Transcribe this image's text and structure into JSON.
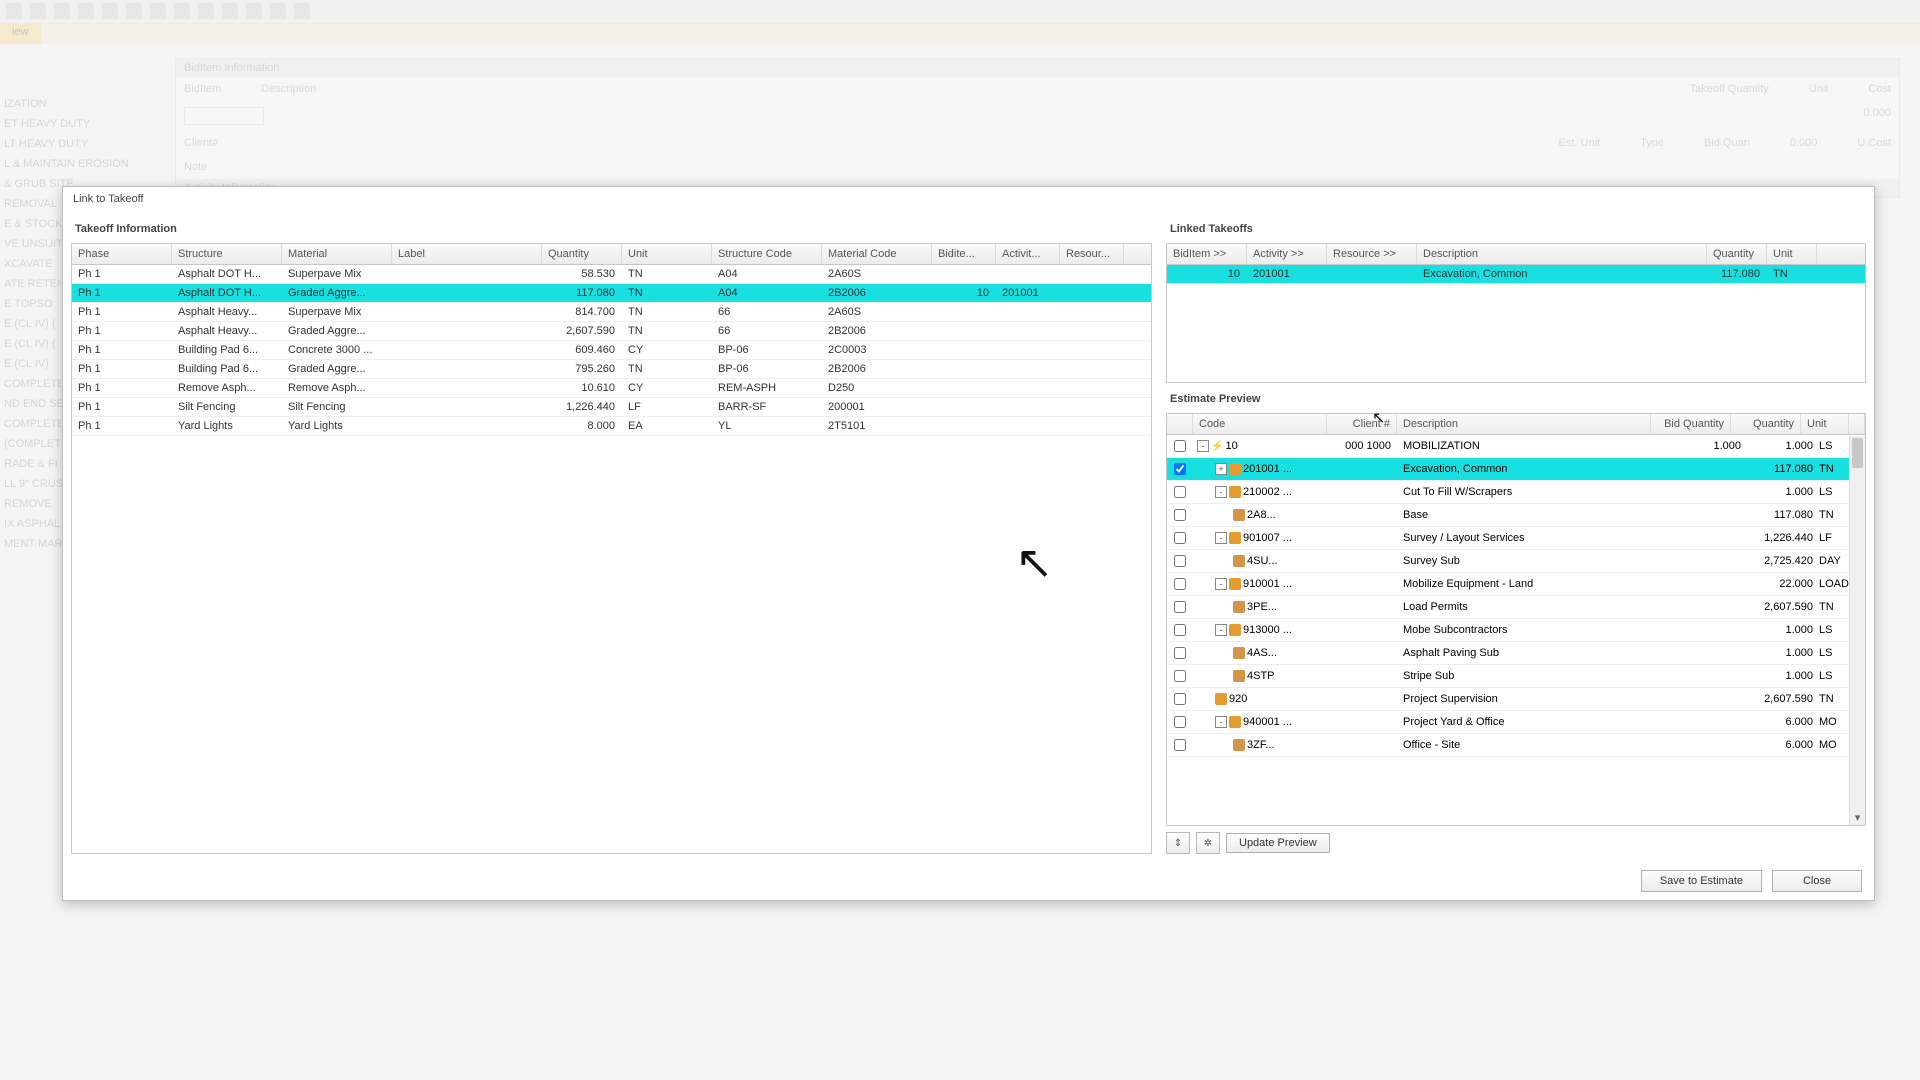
{
  "bg": {
    "tab": "iew",
    "bidItemInfo": "BidItem Information",
    "labels": {
      "biditem": "BidItem",
      "description": "Description",
      "client": "Client#",
      "takeoffQty": "Takeoff Quantity",
      "unit": "Unit",
      "cost": "Cost",
      "estUnit": "Est. Unit",
      "type": "Type",
      "bidQuan": "Bid Quan",
      "ucost": "U.Cost",
      "note": "Note",
      "activityInfo": "Activity Information",
      "qtyVal": "0.000",
      "qtyVal2": "0.000"
    },
    "side": [
      "IZATION",
      "ET HEAVY DUTY",
      "LT HEAVY DUTY",
      "L & MAINTAIN EROSION",
      "& GRUB SITE",
      "REMOVAL",
      "E & STOCK",
      "VE UNSUIT",
      "XCAVATE",
      "ATE RETEN",
      "E TOPSO",
      "E (CL IV) (",
      "E (CL IV) (",
      "E (CL IV)",
      "COMPLETE",
      "ND END SEC",
      "COMPLETE",
      "(COMPLETE",
      "RADE & FI",
      "LL 9\" CRUS",
      "REMOVE",
      "IX ASPHAL",
      "MENT MAR"
    ]
  },
  "dialog": {
    "title": "Link to Takeoff",
    "takeoff": {
      "heading": "Takeoff Information",
      "columns": [
        "Phase",
        "Structure",
        "Material",
        "Label",
        "Quantity",
        "Unit",
        "Structure Code",
        "Material Code",
        "Bidite...",
        "Activit...",
        "Resour..."
      ],
      "rows": [
        {
          "sel": false,
          "phase": "Ph 1",
          "struct": "Asphalt DOT H...",
          "mat": "Superpave Mix",
          "label": "",
          "qty": "58.530",
          "unit": "TN",
          "scode": "A04",
          "mcode": "2A60S",
          "bid": "",
          "act": "",
          "res": ""
        },
        {
          "sel": true,
          "phase": "Ph 1",
          "struct": "Asphalt DOT H...",
          "mat": "Graded Aggre...",
          "label": "",
          "qty": "117.080",
          "unit": "TN",
          "scode": "A04",
          "mcode": "2B2006",
          "bid": "10",
          "act": "201001",
          "res": ""
        },
        {
          "sel": false,
          "phase": "Ph 1",
          "struct": "Asphalt Heavy...",
          "mat": "Superpave Mix",
          "label": "",
          "qty": "814.700",
          "unit": "TN",
          "scode": "66",
          "mcode": "2A60S",
          "bid": "",
          "act": "",
          "res": ""
        },
        {
          "sel": false,
          "phase": "Ph 1",
          "struct": "Asphalt Heavy...",
          "mat": "Graded Aggre...",
          "label": "",
          "qty": "2,607.590",
          "unit": "TN",
          "scode": "66",
          "mcode": "2B2006",
          "bid": "",
          "act": "",
          "res": ""
        },
        {
          "sel": false,
          "phase": "Ph 1",
          "struct": "Building Pad 6...",
          "mat": "Concrete 3000 ...",
          "label": "",
          "qty": "609.460",
          "unit": "CY",
          "scode": "BP-06",
          "mcode": "2C0003",
          "bid": "",
          "act": "",
          "res": ""
        },
        {
          "sel": false,
          "phase": "Ph 1",
          "struct": "Building Pad 6...",
          "mat": "Graded Aggre...",
          "label": "",
          "qty": "795.260",
          "unit": "TN",
          "scode": "BP-06",
          "mcode": "2B2006",
          "bid": "",
          "act": "",
          "res": ""
        },
        {
          "sel": false,
          "phase": "Ph 1",
          "struct": "Remove Asph...",
          "mat": "Remove Asph...",
          "label": "",
          "qty": "10.610",
          "unit": "CY",
          "scode": "REM-ASPH",
          "mcode": "D250",
          "bid": "",
          "act": "",
          "res": ""
        },
        {
          "sel": false,
          "phase": "Ph 1",
          "struct": "Silt Fencing",
          "mat": "Silt Fencing",
          "label": "",
          "qty": "1,226.440",
          "unit": "LF",
          "scode": "BARR-SF",
          "mcode": "200001",
          "bid": "",
          "act": "",
          "res": ""
        },
        {
          "sel": false,
          "phase": "Ph 1",
          "struct": "Yard Lights",
          "mat": "Yard Lights",
          "label": "",
          "qty": "8.000",
          "unit": "EA",
          "scode": "YL",
          "mcode": "2T5101",
          "bid": "",
          "act": "",
          "res": ""
        }
      ]
    },
    "linked": {
      "heading": "Linked Takeoffs",
      "columns": [
        "BidItem >>",
        "Activity >>",
        "Resource >>",
        "Description",
        "Quantity",
        "Unit"
      ],
      "rows": [
        {
          "sel": true,
          "bid": "10",
          "act": "201001",
          "res": "",
          "desc": "Excavation, Common",
          "qty": "117.080",
          "unit": "TN"
        }
      ]
    },
    "estimate": {
      "heading": "Estimate Preview",
      "columns": {
        "code": "Code",
        "client": "Client #",
        "desc": "Description",
        "bidqty": "Bid Quantity",
        "qty": "Quantity",
        "unit": "Unit"
      },
      "rows": [
        {
          "sel": false,
          "chk": false,
          "indent": 0,
          "tog": "-",
          "icon": "bolt",
          "code": "10",
          "client": "000 1000",
          "desc": "MOBILIZATION",
          "bq": "1.000",
          "qty": "1.000",
          "unit": "LS"
        },
        {
          "sel": true,
          "chk": true,
          "indent": 1,
          "tog": "+",
          "icon": "orange",
          "code": "201001 ...",
          "client": "",
          "desc": "Excavation, Common",
          "bq": "",
          "qty": "117.080",
          "unit": "TN"
        },
        {
          "sel": false,
          "chk": false,
          "indent": 1,
          "tog": "-",
          "icon": "orange",
          "code": "210002 ...",
          "client": "",
          "desc": "Cut To Fill W/Scrapers",
          "bq": "",
          "qty": "1.000",
          "unit": "LS"
        },
        {
          "sel": false,
          "chk": false,
          "indent": 2,
          "tog": "",
          "icon": "sub",
          "code": "2A8...",
          "client": "",
          "desc": "Base",
          "bq": "",
          "qty": "117.080",
          "unit": "TN"
        },
        {
          "sel": false,
          "chk": false,
          "indent": 1,
          "tog": "-",
          "icon": "orange",
          "code": "901007 ...",
          "client": "",
          "desc": "Survey / Layout Services",
          "bq": "",
          "qty": "1,226.440",
          "unit": "LF"
        },
        {
          "sel": false,
          "chk": false,
          "indent": 2,
          "tog": "",
          "icon": "sub",
          "code": "4SU...",
          "client": "",
          "desc": "Survey Sub",
          "bq": "",
          "qty": "2,725.420",
          "unit": "DAY"
        },
        {
          "sel": false,
          "chk": false,
          "indent": 1,
          "tog": "-",
          "icon": "orange",
          "code": "910001 ...",
          "client": "",
          "desc": "Mobilize Equipment - Land",
          "bq": "",
          "qty": "22.000",
          "unit": "LOAD"
        },
        {
          "sel": false,
          "chk": false,
          "indent": 2,
          "tog": "",
          "icon": "sub",
          "code": "3PE...",
          "client": "",
          "desc": "Load Permits",
          "bq": "",
          "qty": "2,607.590",
          "unit": "TN"
        },
        {
          "sel": false,
          "chk": false,
          "indent": 1,
          "tog": "-",
          "icon": "orange",
          "code": "913000 ...",
          "client": "",
          "desc": "Mobe Subcontractors",
          "bq": "",
          "qty": "1.000",
          "unit": "LS"
        },
        {
          "sel": false,
          "chk": false,
          "indent": 2,
          "tog": "",
          "icon": "sub",
          "code": "4AS...",
          "client": "",
          "desc": "Asphalt Paving Sub",
          "bq": "",
          "qty": "1.000",
          "unit": "LS"
        },
        {
          "sel": false,
          "chk": false,
          "indent": 2,
          "tog": "",
          "icon": "sub",
          "code": "4STP",
          "client": "",
          "desc": "Stripe Sub",
          "bq": "",
          "qty": "1.000",
          "unit": "LS"
        },
        {
          "sel": false,
          "chk": false,
          "indent": 1,
          "tog": "",
          "icon": "orange",
          "code": "920",
          "client": "",
          "desc": "Project Supervision",
          "bq": "",
          "qty": "2,607.590",
          "unit": "TN"
        },
        {
          "sel": false,
          "chk": false,
          "indent": 1,
          "tog": "-",
          "icon": "orange",
          "code": "940001 ...",
          "client": "",
          "desc": "Project Yard & Office",
          "bq": "",
          "qty": "6.000",
          "unit": "MO"
        },
        {
          "sel": false,
          "chk": false,
          "indent": 2,
          "tog": "",
          "icon": "sub",
          "code": "3ZF...",
          "client": "",
          "desc": "Office - Site",
          "bq": "",
          "qty": "6.000",
          "unit": "MO"
        }
      ],
      "updateBtn": "Update Preview"
    },
    "footer": {
      "save": "Save to Estimate",
      "close": "Close"
    }
  }
}
